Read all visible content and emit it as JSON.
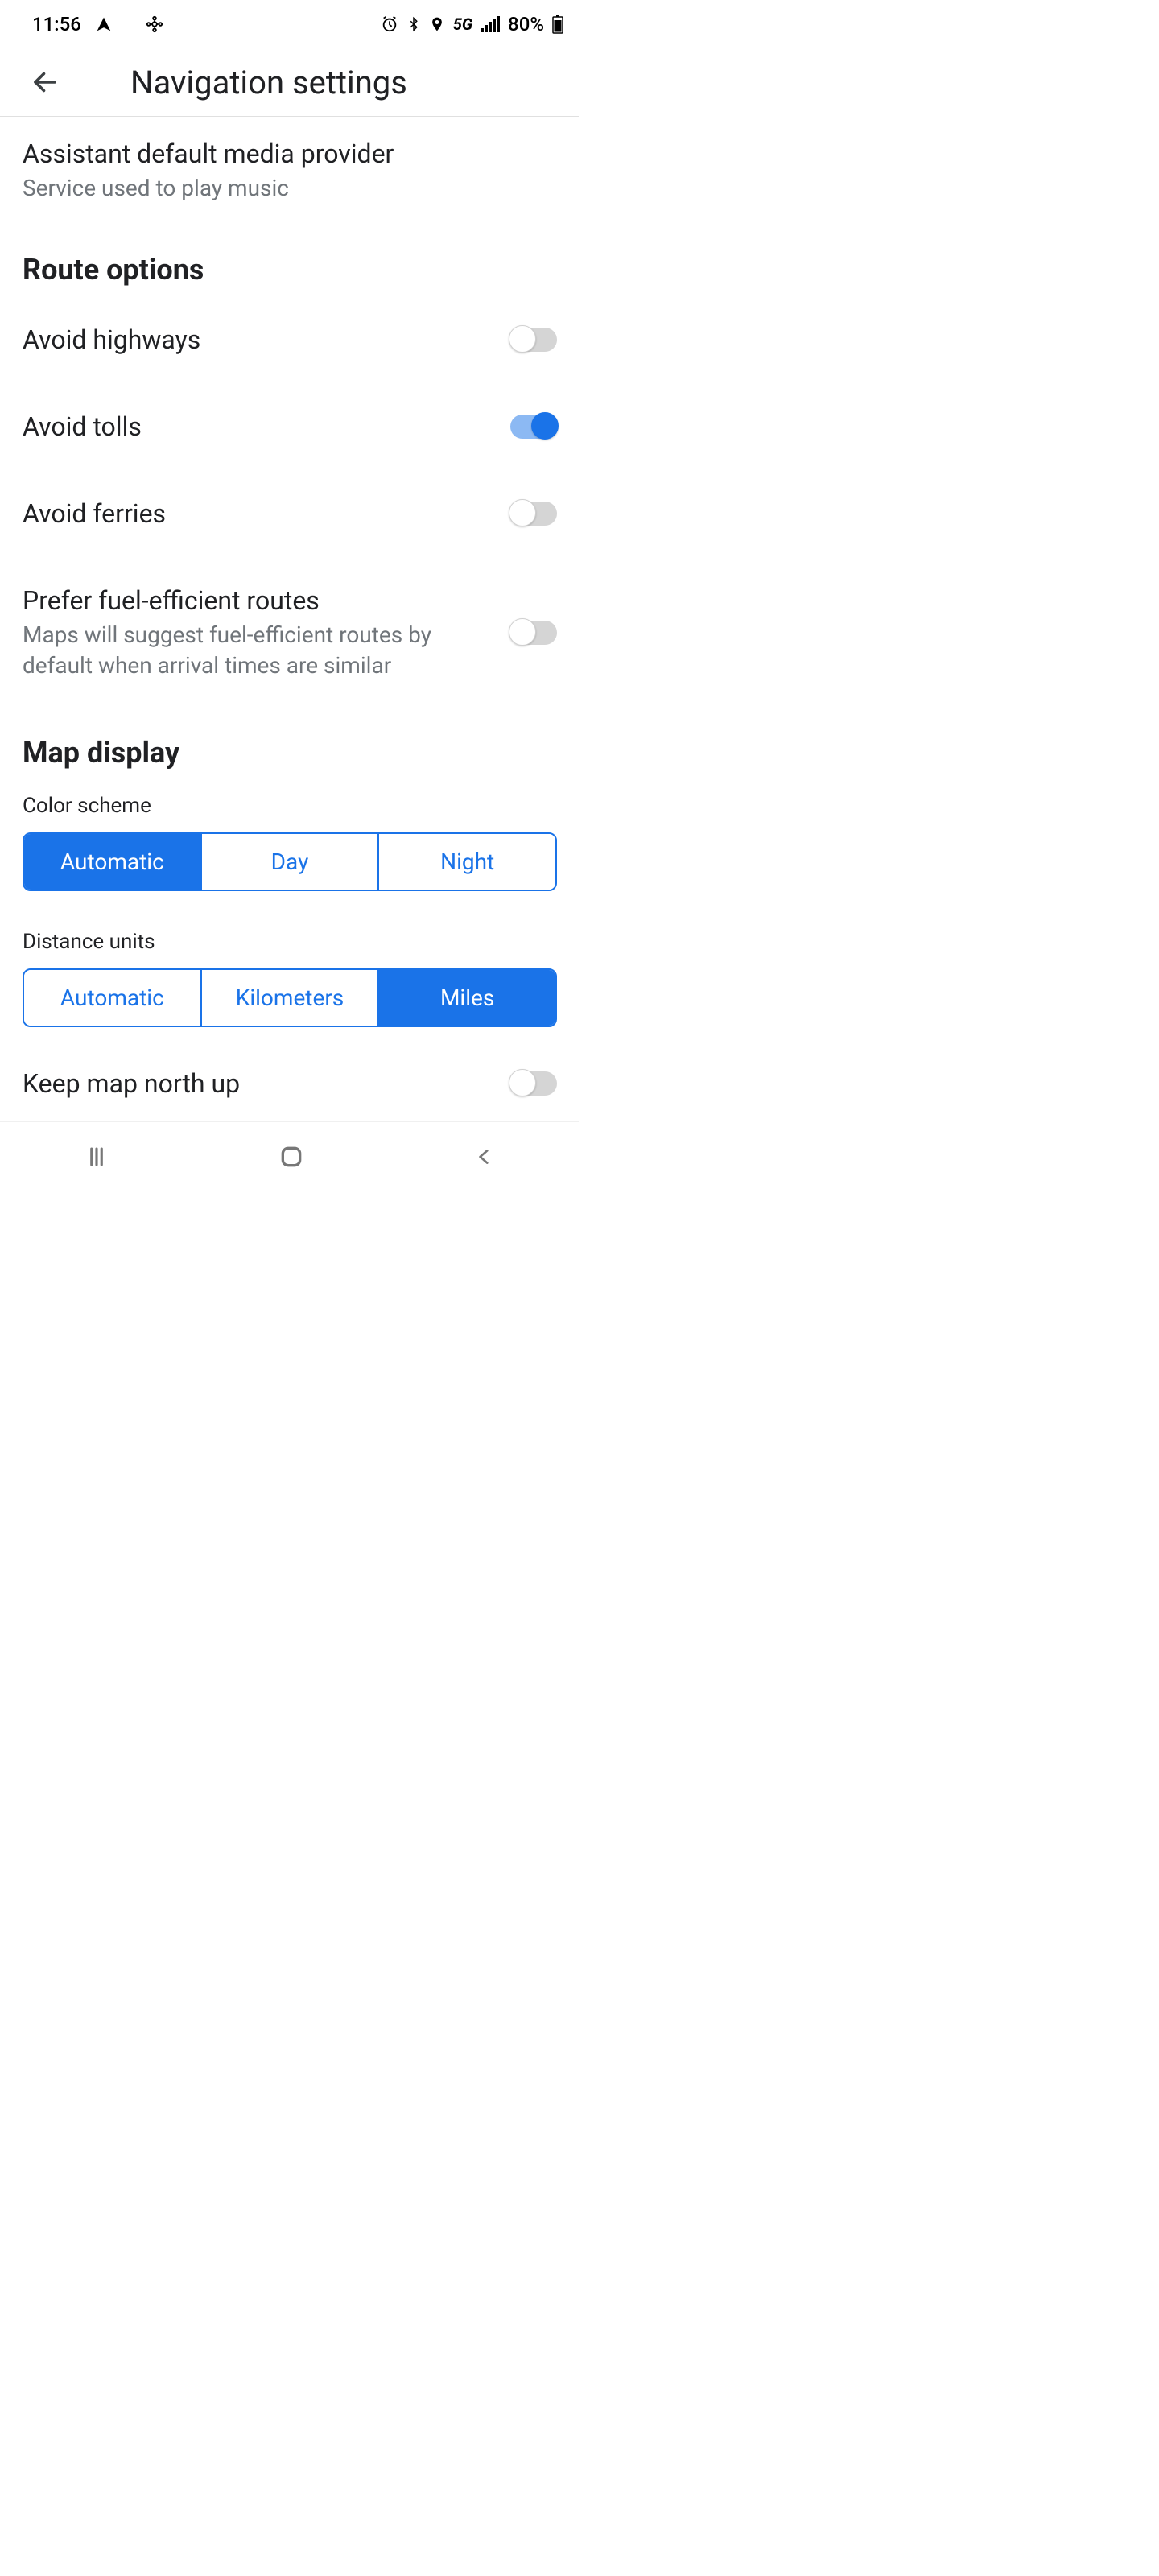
{
  "status": {
    "time": "11:56",
    "battery": "80%",
    "network": "5G"
  },
  "header": {
    "title": "Navigation settings"
  },
  "media_provider": {
    "title": "Assistant default media provider",
    "subtitle": "Service used to play music"
  },
  "colors": {
    "accent": "#1a73e8"
  },
  "route_options": {
    "header": "Route options",
    "avoid_highways": {
      "label": "Avoid highways",
      "on": false
    },
    "avoid_tolls": {
      "label": "Avoid tolls",
      "on": true
    },
    "avoid_ferries": {
      "label": "Avoid ferries",
      "on": false
    },
    "fuel_efficient": {
      "label": "Prefer fuel-efficient routes",
      "subtitle": "Maps will suggest fuel-efficient routes by default when arrival times are similar",
      "on": false
    }
  },
  "map_display": {
    "header": "Map display",
    "color_scheme": {
      "label": "Color scheme",
      "options": [
        "Automatic",
        "Day",
        "Night"
      ],
      "selected_index": 0
    },
    "distance_units": {
      "label": "Distance units",
      "options": [
        "Automatic",
        "Kilometers",
        "Miles"
      ],
      "selected_index": 2
    },
    "north_up": {
      "label": "Keep map north up",
      "on": false
    }
  }
}
